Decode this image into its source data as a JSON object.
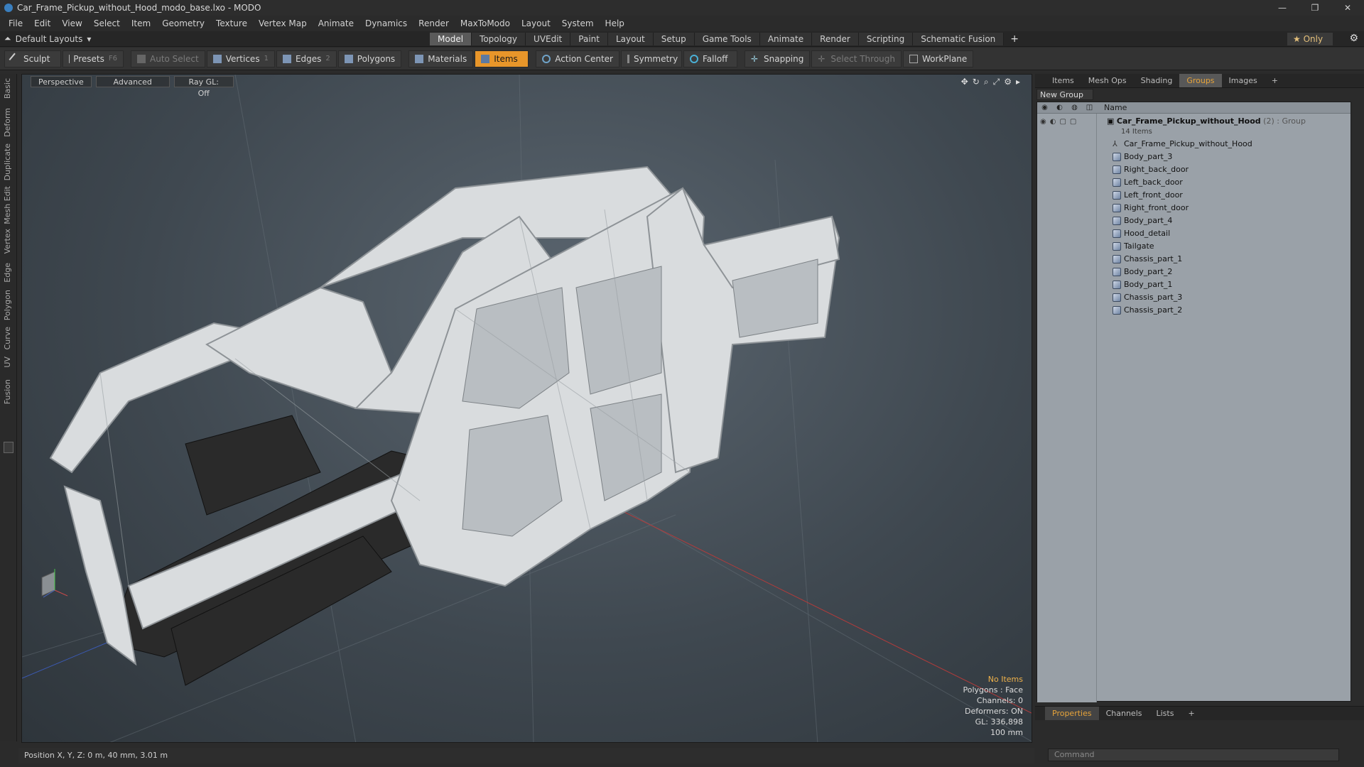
{
  "window": {
    "title": "Car_Frame_Pickup_without_Hood_modo_base.lxo - MODO",
    "min": "—",
    "max": "❐",
    "close": "✕"
  },
  "menu": [
    "File",
    "Edit",
    "View",
    "Select",
    "Item",
    "Geometry",
    "Texture",
    "Vertex Map",
    "Animate",
    "Dynamics",
    "Render",
    "MaxToModo",
    "Layout",
    "System",
    "Help"
  ],
  "layout": {
    "preset": "Default Layouts",
    "only_label": "Only"
  },
  "tabs": [
    "Model",
    "Topology",
    "UVEdit",
    "Paint",
    "Layout",
    "Setup",
    "Game Tools",
    "Animate",
    "Render",
    "Scripting",
    "Schematic Fusion"
  ],
  "active_tab": "Model",
  "toolbar": {
    "sculpt": "Sculpt",
    "presets": "Presets",
    "presets_key": "F6",
    "auto_select": "Auto Select",
    "vertices": "Vertices",
    "vertices_key": "1",
    "edges": "Edges",
    "edges_key": "2",
    "polygons": "Polygons",
    "materials": "Materials",
    "items": "Items",
    "action_center": "Action Center",
    "symmetry": "Symmetry",
    "falloff": "Falloff",
    "snapping": "Snapping",
    "select_through": "Select Through",
    "workplane": "WorkPlane"
  },
  "left_tabs": [
    "Basic",
    "Deform",
    "Duplicate",
    "Mesh Edit",
    "Vertex",
    "Edge",
    "Polygon",
    "Curve",
    "UV",
    "Fusion"
  ],
  "viewport": {
    "perspective": "Perspective",
    "advanced": "Advanced",
    "raygl": "Ray GL: Off",
    "info": {
      "no_items": "No Items",
      "polygons": "Polygons : Face",
      "channels": "Channels: 0",
      "deformers": "Deformers: ON",
      "gl": "GL: 336,898",
      "scale": "100 mm"
    }
  },
  "status": {
    "position": "Position X, Y, Z:  0 m, 40 mm, 3.01 m"
  },
  "right_panel": {
    "tabs": [
      "Items",
      "Mesh Ops",
      "Shading",
      "Groups",
      "Images"
    ],
    "active_tab": "Groups",
    "new_group": "New Group",
    "name_header": "Name",
    "group": {
      "name": "Car_Frame_Pickup_without_Hood",
      "count": "(2)",
      "type": ": Group",
      "sub": "14 Items"
    },
    "locator": "Car_Frame_Pickup_without_Hood",
    "items": [
      "Body_part_3",
      "Right_back_door",
      "Left_back_door",
      "Left_front_door",
      "Right_front_door",
      "Body_part_4",
      "Hood_detail",
      "Tailgate",
      "Chassis_part_1",
      "Body_part_2",
      "Body_part_1",
      "Chassis_part_3",
      "Chassis_part_2"
    ],
    "prop_tabs": [
      "Properties",
      "Channels",
      "Lists"
    ],
    "command_placeholder": "Command"
  }
}
